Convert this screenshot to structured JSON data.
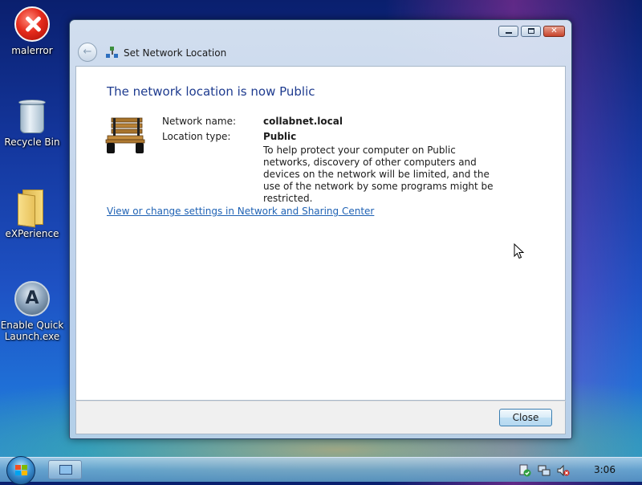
{
  "desktop": {
    "icons": [
      {
        "label": "malerror",
        "icon": "error-icon"
      },
      {
        "label": "Recycle Bin",
        "icon": "recycle-bin-icon"
      },
      {
        "label": "eXPerience",
        "icon": "folder-icon"
      },
      {
        "label": "Enable Quick\nLaunch.exe",
        "icon": "quick-launch-icon"
      }
    ]
  },
  "window": {
    "title": "Set Network Location",
    "heading": "The network location is now Public",
    "network_name_label": "Network name:",
    "network_name_value": "collabnet.local",
    "location_type_label": "Location type:",
    "location_type_value": "Public",
    "description": "To help protect your computer on Public networks, discovery of other computers and devices on the network will be limited, and the use of the network by some programs might be restricted.",
    "link": "View or change settings in Network and Sharing Center",
    "close_button": "Close",
    "location_icon": "park-bench-icon"
  },
  "taskbar": {
    "clock": "3:06"
  },
  "colors": {
    "heading": "#1e3b8f",
    "link": "#1f62b4"
  }
}
